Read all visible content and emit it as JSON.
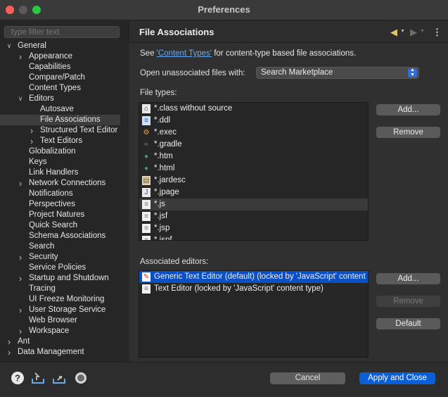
{
  "window": {
    "title": "Preferences"
  },
  "filter": {
    "placeholder": "type filter text"
  },
  "tree": [
    {
      "label": "General",
      "level": 0,
      "expander": "open"
    },
    {
      "label": "Appearance",
      "level": 1,
      "expander": "closed"
    },
    {
      "label": "Capabilities",
      "level": 1,
      "expander": "none"
    },
    {
      "label": "Compare/Patch",
      "level": 1,
      "expander": "none"
    },
    {
      "label": "Content Types",
      "level": 1,
      "expander": "none"
    },
    {
      "label": "Editors",
      "level": 1,
      "expander": "open"
    },
    {
      "label": "Autosave",
      "level": 2,
      "expander": "none"
    },
    {
      "label": "File Associations",
      "level": 2,
      "expander": "none",
      "selected": true
    },
    {
      "label": "Structured Text Editor",
      "level": 2,
      "expander": "closed"
    },
    {
      "label": "Text Editors",
      "level": 2,
      "expander": "closed"
    },
    {
      "label": "Globalization",
      "level": 1,
      "expander": "none"
    },
    {
      "label": "Keys",
      "level": 1,
      "expander": "none"
    },
    {
      "label": "Link Handlers",
      "level": 1,
      "expander": "none"
    },
    {
      "label": "Network Connections",
      "level": 1,
      "expander": "closed"
    },
    {
      "label": "Notifications",
      "level": 1,
      "expander": "none"
    },
    {
      "label": "Perspectives",
      "level": 1,
      "expander": "none"
    },
    {
      "label": "Project Natures",
      "level": 1,
      "expander": "none"
    },
    {
      "label": "Quick Search",
      "level": 1,
      "expander": "none"
    },
    {
      "label": "Schema Associations",
      "level": 1,
      "expander": "none"
    },
    {
      "label": "Search",
      "level": 1,
      "expander": "none"
    },
    {
      "label": "Security",
      "level": 1,
      "expander": "closed"
    },
    {
      "label": "Service Policies",
      "level": 1,
      "expander": "none"
    },
    {
      "label": "Startup and Shutdown",
      "level": 1,
      "expander": "closed"
    },
    {
      "label": "Tracing",
      "level": 1,
      "expander": "none"
    },
    {
      "label": "UI Freeze Monitoring",
      "level": 1,
      "expander": "none"
    },
    {
      "label": "User Storage Service",
      "level": 1,
      "expander": "closed"
    },
    {
      "label": "Web Browser",
      "level": 1,
      "expander": "none"
    },
    {
      "label": "Workspace",
      "level": 1,
      "expander": "closed"
    },
    {
      "label": "Ant",
      "level": 0,
      "expander": "closed"
    },
    {
      "label": "Data Management",
      "level": 0,
      "expander": "closed"
    }
  ],
  "page": {
    "title": "File Associations",
    "see_prefix": "See ",
    "see_link": "'Content Types'",
    "see_suffix": " for content-type based file associations.",
    "open_unassociated_label": "Open unassociated files with:",
    "open_unassociated_value": "Search Marketplace",
    "file_types_label": "File types:",
    "associated_editors_label": "Associated editors:"
  },
  "file_types": [
    {
      "label": "*.class without source",
      "icon": "class-file-icon"
    },
    {
      "label": "*.ddl",
      "icon": "ddl-file-icon"
    },
    {
      "label": "*.exec",
      "icon": "exec-file-icon"
    },
    {
      "label": "*.gradle",
      "icon": "gradle-file-icon"
    },
    {
      "label": "*.htm",
      "icon": "web-globe-icon"
    },
    {
      "label": "*.html",
      "icon": "web-globe-icon"
    },
    {
      "label": "*.jardesc",
      "icon": "jardesc-file-icon"
    },
    {
      "label": "*.jpage",
      "icon": "jpage-file-icon"
    },
    {
      "label": "*.js",
      "icon": "text-file-icon",
      "highlighted": true
    },
    {
      "label": "*.jsf",
      "icon": "text-file-icon"
    },
    {
      "label": "*.jsp",
      "icon": "text-file-icon"
    },
    {
      "label": "*.jspf",
      "icon": "text-file-icon"
    }
  ],
  "associated_editors": [
    {
      "label": "Generic Text Editor (default) (locked by 'JavaScript' content type)",
      "icon": "generic-editor-icon",
      "selected": true
    },
    {
      "label": "Text Editor (locked by 'JavaScript' content type)",
      "icon": "text-file-icon"
    }
  ],
  "buttons": {
    "file_types_add": "Add...",
    "file_types_remove": "Remove",
    "editors_add": "Add...",
    "editors_remove": "Remove",
    "editors_default": "Default",
    "cancel": "Cancel",
    "apply_close": "Apply and Close"
  },
  "colors": {
    "accent": "#0a5fd6",
    "selection": "#0a50c4",
    "link": "#6aaaf5"
  }
}
